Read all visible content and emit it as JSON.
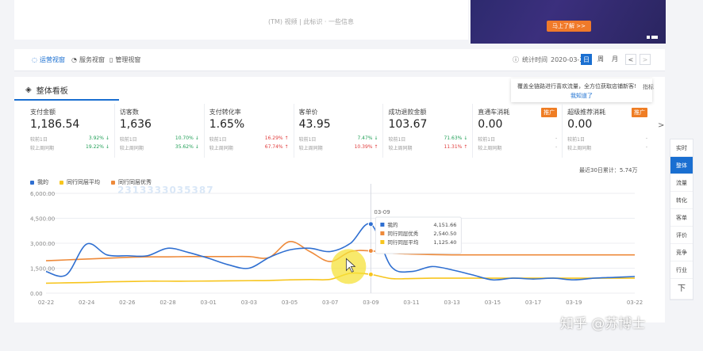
{
  "top": {
    "faint_text": "(TM) 视频 | 此标识  · 一些信息",
    "banner_button": "马上了解 >>"
  },
  "tabs": [
    {
      "label": "运营视窗",
      "icon": "dashboard-icon"
    },
    {
      "label": "服务视窗",
      "icon": "service-icon"
    },
    {
      "label": "管理视窗",
      "icon": "management-icon"
    }
  ],
  "stat_time": {
    "label": "统计时间",
    "value": "2020-03-22",
    "segments": [
      "日",
      "周",
      "月"
    ],
    "prev": "<",
    "next": ">"
  },
  "panel": {
    "title": "整体看板",
    "tooltip_text": "覆盖全链路进行喜欢流量，全方位获取店铺新客!",
    "tooltip_link": "我知道了",
    "tooltip_side": "指标",
    "cumulative": "最近30日累计：5.74万",
    "watermark": "2313333035387",
    "next_arrow": ">"
  },
  "metrics": [
    {
      "label": "支付金额",
      "value": "1,186.54",
      "r1_label": "较前1日",
      "r1_pct": "3.92%",
      "r1_dir": "down",
      "r2_label": "较上周同期",
      "r2_pct": "19.22%",
      "r2_dir": "down",
      "badge": ""
    },
    {
      "label": "访客数",
      "value": "1,636",
      "r1_label": "较前1日",
      "r1_pct": "10.70%",
      "r1_dir": "down",
      "r2_label": "较上周同期",
      "r2_pct": "35.62%",
      "r2_dir": "down",
      "badge": ""
    },
    {
      "label": "支付转化率",
      "value": "1.65%",
      "r1_label": "较前1日",
      "r1_pct": "16.29%",
      "r1_dir": "up",
      "r2_label": "较上周同期",
      "r2_pct": "67.74%",
      "r2_dir": "up",
      "badge": ""
    },
    {
      "label": "客单价",
      "value": "43.95",
      "r1_label": "较前1日",
      "r1_pct": "7.47%",
      "r1_dir": "down",
      "r2_label": "较上周同期",
      "r2_pct": "10.39%",
      "r2_dir": "up",
      "badge": ""
    },
    {
      "label": "成功退款金额",
      "value": "103.67",
      "r1_label": "较前1日",
      "r1_pct": "71.63%",
      "r1_dir": "down",
      "r2_label": "较上周同期",
      "r2_pct": "11.31%",
      "r2_dir": "up",
      "badge": ""
    },
    {
      "label": "直通车消耗",
      "value": "0.00",
      "r1_label": "较前1日",
      "r1_pct": "-",
      "r1_dir": "neu",
      "r2_label": "较上周同期",
      "r2_pct": "-",
      "r2_dir": "neu",
      "badge": "推广"
    },
    {
      "label": "超级推荐消耗",
      "value": "0.00",
      "r1_label": "较前1日",
      "r1_pct": "-",
      "r1_dir": "neu",
      "r2_label": "较上周同期",
      "r2_pct": "-",
      "r2_dir": "neu",
      "badge": "推广"
    }
  ],
  "rail": [
    "实时",
    "整体",
    "流量",
    "转化",
    "客单",
    "评价",
    "竞争",
    "行业",
    "下"
  ],
  "credit": "知乎 @苏博士",
  "colors": {
    "mine": "#2f6fd1",
    "avg": "#f7c51e",
    "excellent": "#ee8a3a",
    "accent": "#1a6fd1"
  },
  "chart_data": {
    "type": "line",
    "x": [
      "02-22",
      "02-23",
      "02-24",
      "02-25",
      "02-26",
      "02-27",
      "02-28",
      "02-29",
      "03-01",
      "03-02",
      "03-03",
      "03-04",
      "03-05",
      "03-06",
      "03-07",
      "03-08",
      "03-09",
      "03-10",
      "03-11",
      "03-12",
      "03-13",
      "03-14",
      "03-15",
      "03-16",
      "03-17",
      "03-18",
      "03-19",
      "03-20",
      "03-21",
      "03-22"
    ],
    "tick_labels": [
      "02-22",
      "02-24",
      "02-26",
      "02-28",
      "03-01",
      "03-03",
      "03-05",
      "03-07",
      "03-09",
      "03-11",
      "03-13",
      "03-15",
      "03-17",
      "03-19",
      "03-22"
    ],
    "ylim": [
      0,
      6000
    ],
    "yticks": [
      "6,000.00",
      "4,500.00",
      "3,000.00",
      "1,500.00",
      "0.00"
    ],
    "series": [
      {
        "name": "我的",
        "color": "#2f6fd1",
        "values": [
          1300,
          1100,
          2950,
          2300,
          2250,
          2250,
          2700,
          2450,
          2100,
          1700,
          1500,
          2150,
          2600,
          2700,
          2500,
          3000,
          4151.66,
          1600,
          1300,
          1600,
          1400,
          1100,
          800,
          900,
          850,
          900,
          800,
          900,
          950,
          1000
        ]
      },
      {
        "name": "同行同层平均",
        "color": "#f7c51e",
        "values": [
          600,
          620,
          640,
          680,
          700,
          720,
          720,
          720,
          730,
          740,
          750,
          760,
          800,
          820,
          830,
          1200,
          1125.4,
          880,
          880,
          900,
          900,
          900,
          900,
          900,
          900,
          900,
          900,
          900,
          900,
          900
        ]
      },
      {
        "name": "同行同层优秀",
        "color": "#ee8a3a",
        "values": [
          1950,
          2000,
          2050,
          2100,
          2150,
          2180,
          2180,
          2200,
          2200,
          2200,
          2200,
          2150,
          3100,
          2500,
          1900,
          2500,
          2540.5,
          2400,
          2350,
          2320,
          2300,
          2300,
          2300,
          2300,
          2300,
          2300,
          2300,
          2300,
          2300,
          2300
        ]
      }
    ],
    "tooltip": {
      "date": "03-09",
      "rows": [
        {
          "name": "我的",
          "value": "4,151.66"
        },
        {
          "name": "同行同层优秀",
          "value": "2,540.50"
        },
        {
          "name": "同行同层平均",
          "value": "1,125.40"
        }
      ]
    },
    "grid": true,
    "legend_position": "top-left"
  }
}
